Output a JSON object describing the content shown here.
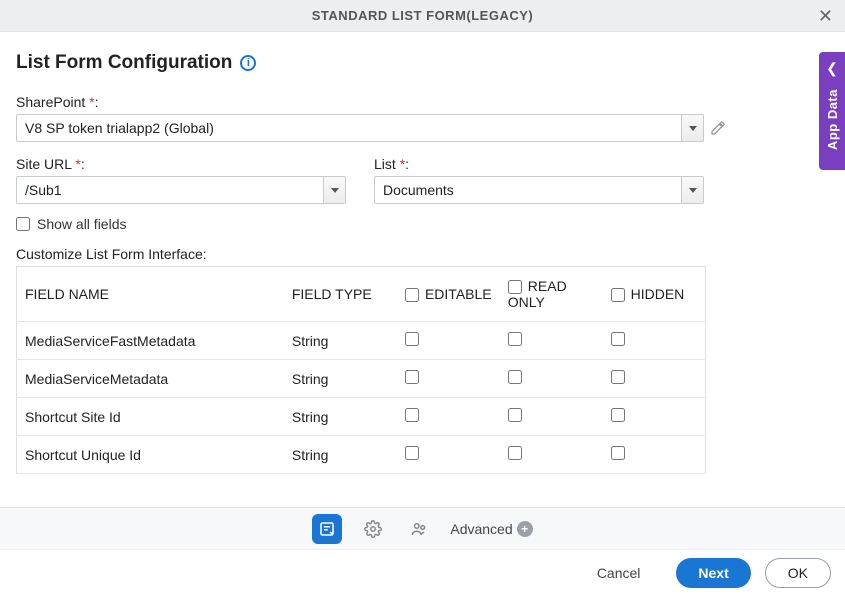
{
  "titleBar": {
    "title": "STANDARD LIST FORM(LEGACY)"
  },
  "sideTab": {
    "label": "App Data"
  },
  "pageTitle": "List Form Configuration",
  "sharepoint": {
    "label": "SharePoint",
    "value": "V8 SP token trialapp2 (Global)"
  },
  "siteUrl": {
    "label": "Site URL",
    "value": "/Sub1"
  },
  "list": {
    "label": "List",
    "value": "Documents"
  },
  "showAllFields": {
    "label": "Show all fields",
    "checked": false
  },
  "sectionLabel": "Customize List Form Interface:",
  "table": {
    "headers": {
      "name": "FIELD NAME",
      "type": "FIELD TYPE",
      "editable": "EDITABLE",
      "readonly": "READ ONLY",
      "hidden": "HIDDEN"
    },
    "rows": [
      {
        "name": "MediaServiceFastMetadata",
        "type": "String",
        "editable": false,
        "readonly": false,
        "hidden": false
      },
      {
        "name": "MediaServiceMetadata",
        "type": "String",
        "editable": false,
        "readonly": false,
        "hidden": false
      },
      {
        "name": "Shortcut Site Id",
        "type": "String",
        "editable": false,
        "readonly": false,
        "hidden": false
      },
      {
        "name": "Shortcut Unique Id",
        "type": "String",
        "editable": false,
        "readonly": false,
        "hidden": false
      }
    ]
  },
  "toolbar": {
    "advanced": "Advanced"
  },
  "footer": {
    "cancel": "Cancel",
    "next": "Next",
    "ok": "OK"
  }
}
